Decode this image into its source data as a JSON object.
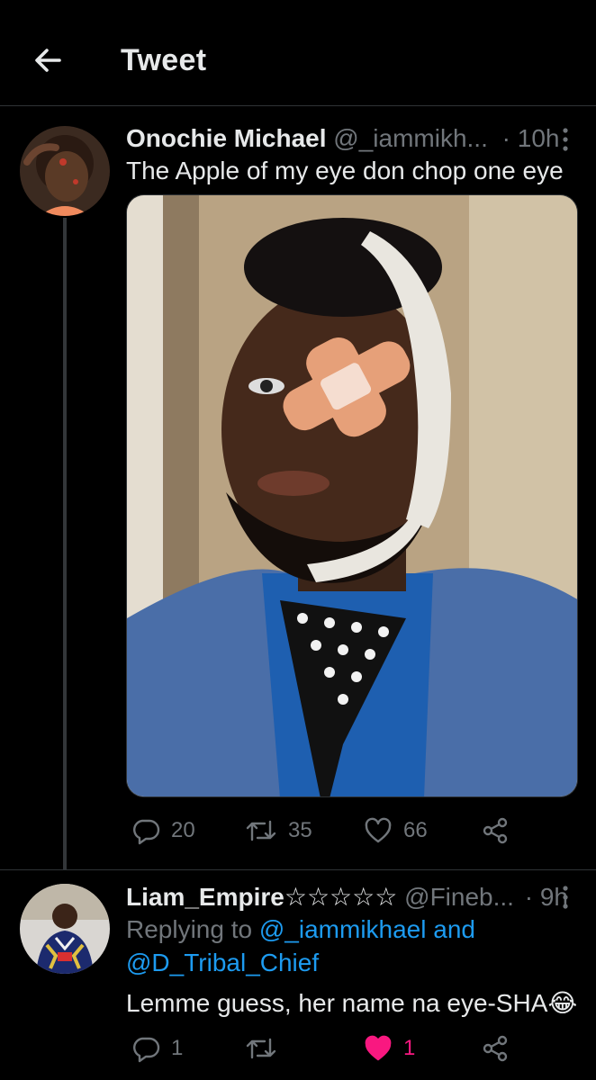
{
  "header": {
    "title": "Tweet"
  },
  "main_tweet": {
    "display_name": "Onochie Michael",
    "handle": "@_iammikh...",
    "time": "· 10h",
    "text": "The Apple of my eye don chop one eye",
    "stats": {
      "replies": "20",
      "retweets": "35",
      "likes": "66"
    }
  },
  "reply_tweet": {
    "display_name": "Liam_Empire☆☆☆☆☆",
    "handle": "@Fineb...",
    "time": "· 9h",
    "replying_prefix": "Replying to",
    "replying_mentions_1": "@_iammikhael and",
    "replying_mentions_2": "@D_Tribal_Chief",
    "text": "Lemme guess, her name na eye-SHA😂",
    "stats": {
      "replies": "1",
      "retweets": "",
      "likes": "1"
    }
  },
  "colors": {
    "background": "#000000",
    "text": "#e7e9ea",
    "muted": "#71767b",
    "link": "#1d9bf0",
    "like": "#f91880",
    "border": "#2f3336"
  },
  "icons": [
    "back-arrow-icon",
    "more-icon",
    "reply-icon",
    "retweet-icon",
    "like-icon",
    "share-icon"
  ]
}
